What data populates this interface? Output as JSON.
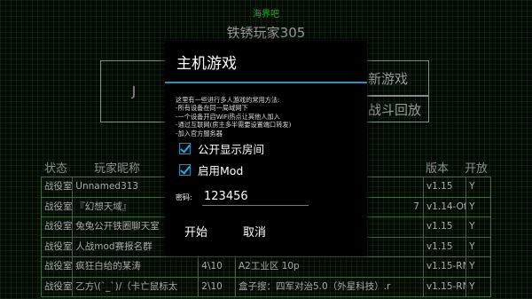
{
  "top_badge": "海界吧",
  "page_title": "铁锈玩家305",
  "buttons": {
    "left": "J",
    "new_game": "新游戏",
    "battle_replay": "战斗回放"
  },
  "table": {
    "headers": {
      "status": "状态",
      "player_name": "玩家昵称",
      "version": "版本",
      "open": "开放"
    },
    "rows": [
      [
        "战役室",
        "Unnamed313",
        "",
        "",
        "v1.15",
        "Y"
      ],
      [
        "战役室",
        "『幻想天域』",
        "",
        "7",
        "v1.14-Oth",
        "Y"
      ],
      [
        "战役室",
        "兔兔公开铁圈聊天室",
        "",
        "",
        "v1.15",
        "Y"
      ],
      [
        "战役室",
        "人战mod赛报名群",
        "",
        "",
        "v1.15",
        "Y"
      ],
      [
        "战役室",
        "疯狂白给的某涛",
        "4\\10",
        "A2工业区 10p",
        "v1.15-RN-",
        "Y"
      ],
      [
        "战役室",
        "乙方\\(`_`)/（卡亡鼠标太",
        "2\\10",
        "盒子搜：四军对治5.0（外星科技）.r",
        "v1.15-RN-",
        "Y"
      ]
    ]
  },
  "dialog": {
    "title": "主机游戏",
    "description": [
      "这里有一些进行多人游戏的常用方法:",
      "-所有设备在同一局域网下",
      "-一个设备开启WiFi热点让其他人加入",
      "-通过互联网(房主多半需要设置端口转发)",
      "-加入官方服务器"
    ],
    "public_room_label": "公开显示房间",
    "enable_mod_label": "启用Mod",
    "password_label": "密码:",
    "password_value": "123456",
    "start_label": "开始",
    "cancel_label": "取消"
  },
  "colors": {
    "accent": "#2b8fbf",
    "grid_line": "#3a6a3a",
    "badge_green": "#20b020"
  }
}
